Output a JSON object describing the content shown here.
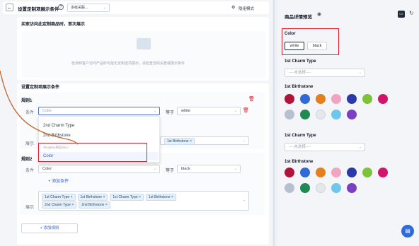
{
  "header": {
    "title": "设置定制项展示条件",
    "dropdown_label": "多级关联...",
    "mode_label": "隐组模式"
  },
  "first_section": {
    "title": "买家访问此定制商品时，首次展示",
    "empty_text": "检测到客户访问产品时可能无定制选项展示，请检查您的设置或展示条件"
  },
  "conditions": {
    "section_title": "设置定制项展示条件",
    "rule1": {
      "label": "规则1",
      "condition_label": "条件",
      "placeholder": "Color",
      "operator": "等于",
      "value": "white",
      "display_label": "展示",
      "display_tag": "1st Birthstone ×"
    },
    "dropdown": {
      "options": [
        "2nd Charm Type",
        "2nd Birthstone"
      ],
      "group_label": "Shopline商品SKU",
      "selected_option": "Color"
    },
    "rule2": {
      "label": "规则2",
      "condition_label": "条件",
      "field": "Color",
      "operator": "等于",
      "value": "black",
      "add_condition": "+ 添加条件",
      "display_label": "展示",
      "tags_row1": [
        "1st Charm Type ×",
        "1st Birthstone ×",
        "1st Charm Type ×",
        "1st Birthstone ×"
      ],
      "tags_row2": [
        "2nd Charm Type ×",
        "2nd Birthstone ×"
      ]
    },
    "add_rule": "+ 添加规则"
  },
  "preview": {
    "title": "商品详情预览",
    "color_label": "Color",
    "color_options": [
      "white",
      "black"
    ],
    "charm1_label": "1st Charm Type",
    "charm1_placeholder": "----未选择----",
    "birthstone1_label": "1st Birthstone",
    "charm2_label": "1st Charm Type",
    "charm2_placeholder": "----未选择----",
    "birthstone2_label": "1st Birthstone"
  },
  "colors": {
    "accent": "#3060c8",
    "highlight": "#e11d2e",
    "tag_bg": "#e6f0fb",
    "connector": "#c2672e"
  },
  "gem_colors": [
    "#b0143a",
    "#2f6bd6",
    "#e2801e",
    "#f2a3c4",
    "#2a3aa8",
    "#7cc23a",
    "#d3146b",
    "#b7c0cf",
    "#1f8a52",
    "#e5e7eb",
    "#6ec7ea",
    "#7b3fc4"
  ]
}
